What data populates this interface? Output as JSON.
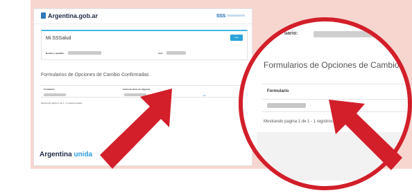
{
  "header": {
    "gov_brand": "Argentina.gob.ar",
    "sss_brand": "SSS"
  },
  "card": {
    "title": "Mi SSSalud",
    "top_button": "Salir",
    "name_label": "Nombre y apellido:",
    "cuit_label": "Cuit:"
  },
  "section": {
    "title": "Formularios de Opciones de Cambio Confirmadas",
    "columns": [
      "Formulario",
      "Fecha de Inicio de Vigencia"
    ],
    "row_link": "Ver",
    "showing": "Mostrando pagina 1 de 1 - 1 registros totales"
  },
  "footer": {
    "brand_main": "Argentina",
    "brand_accent": "unida"
  },
  "zoom": {
    "user_label": "uario:",
    "title": "Formularios de Opciones de Cambio",
    "column": "Formulario",
    "showing": "Mostrando pagina 1 de 1 - 1 registros"
  },
  "colors": {
    "accent": "#d21f2a",
    "panel": "#f6d6cf",
    "link": "#2d8bd0"
  }
}
